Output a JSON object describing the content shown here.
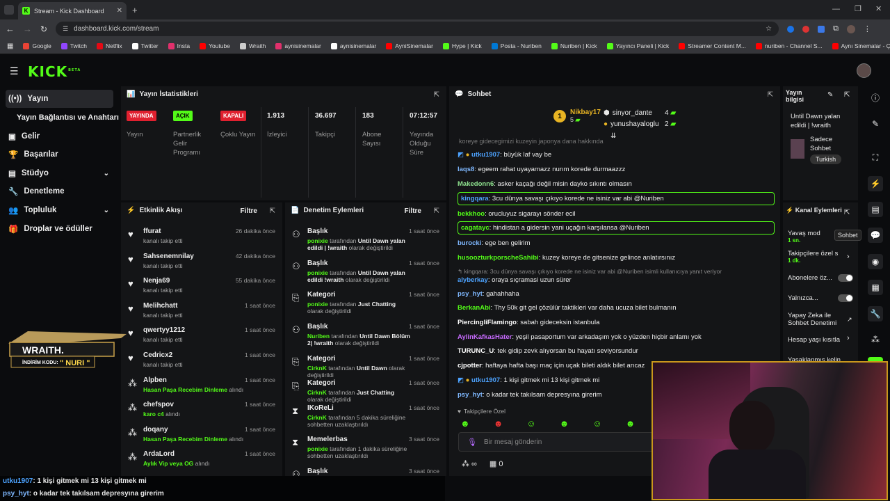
{
  "browser": {
    "tab_title": "Stream - Kick Dashboard",
    "url": "dashboard.kick.com/stream",
    "bookmarks": [
      {
        "label": "Google",
        "color": "#ea4335"
      },
      {
        "label": "Twitch",
        "color": "#9146ff"
      },
      {
        "label": "Netflix",
        "color": "#e50914"
      },
      {
        "label": "Twitter",
        "color": "#ffffff"
      },
      {
        "label": "Insta",
        "color": "#e1306c"
      },
      {
        "label": "Youtube",
        "color": "#ff0000"
      },
      {
        "label": "Wraith",
        "color": "#cccccc"
      },
      {
        "label": "aynisinemalar",
        "color": "#e1306c"
      },
      {
        "label": "aynisinemalar",
        "color": "#ffffff"
      },
      {
        "label": "AyniSinemalar",
        "color": "#ff0000"
      },
      {
        "label": "Hype | Kick",
        "color": "#53fc18"
      },
      {
        "label": "Posta - Nuriben",
        "color": "#0078d4"
      },
      {
        "label": "Nuriben | Kick",
        "color": "#53fc18"
      },
      {
        "label": "Yayıncı Paneli | Kick",
        "color": "#53fc18"
      },
      {
        "label": "Streamer Content M...",
        "color": "#ff0000"
      },
      {
        "label": "nuriben - Channel S...",
        "color": "#ff0000"
      },
      {
        "label": "Aynı Sinemalar - Ça...",
        "color": "#ff0000"
      }
    ]
  },
  "app": {
    "logo": "KICK",
    "logo_sup": "BETA"
  },
  "sidebar": {
    "items": [
      {
        "label": "Yayın",
        "icon": "broadcast-icon"
      },
      {
        "label": "Yayın Bağlantısı ve Anahtarı",
        "icon": ""
      },
      {
        "label": "Gelir",
        "icon": "revenue-icon"
      },
      {
        "label": "Başarılar",
        "icon": "trophy-icon"
      },
      {
        "label": "Stüdyo",
        "icon": "studio-icon"
      },
      {
        "label": "Denetleme",
        "icon": "wrench-icon"
      },
      {
        "label": "Topluluk",
        "icon": "people-icon"
      },
      {
        "label": "Droplar ve ödüller",
        "icon": "gift-icon"
      }
    ]
  },
  "stats": {
    "title": "Yayın İstatistikleri",
    "cols": [
      {
        "badge": "YAYINDA",
        "label": "Yayın"
      },
      {
        "badge": "AÇIK",
        "label": "Partnerlik Gelir Programı"
      },
      {
        "badge": "KAPALI",
        "label": "Çoklu Yayın"
      },
      {
        "value": "1.913",
        "label": "İzleyici"
      },
      {
        "value": "36.697",
        "label": "Takipçi"
      },
      {
        "value": "183",
        "label": "Abone Sayısı"
      },
      {
        "value": "07:12:57",
        "label": "Yayında Olduğu Süre"
      }
    ]
  },
  "activity": {
    "title": "Etkinlik Akışı",
    "filter": "Filtre",
    "items": [
      {
        "name": "ffurat",
        "sub": "kanalı takip etti",
        "time": "26 dakika önce"
      },
      {
        "name": "Sahsenemnilay",
        "sub": "kanalı takip etti",
        "time": "42 dakika önce"
      },
      {
        "name": "Nenja69",
        "sub": "kanalı takip etti",
        "time": "55 dakika önce"
      },
      {
        "name": "Melihchatt",
        "sub": "kanalı takip etti",
        "time": "1 saat önce"
      },
      {
        "name": "qwertyy1212",
        "sub": "kanalı takip etti",
        "time": "1 saat önce"
      },
      {
        "name": "Cedricx2",
        "sub": "kanalı takip etti",
        "time": "1 saat önce"
      },
      {
        "name": "Alpben",
        "sub_g": "Hasan Paşa Recebim Dinleme",
        "sub": " alındı",
        "time": "1 saat önce"
      },
      {
        "name": "chefspov",
        "sub_g": "karo c4",
        "sub": " alındı",
        "time": "1 saat önce"
      },
      {
        "name": "doqany",
        "sub_g": "Hasan Paşa Recebim Dinleme",
        "sub": " alındı",
        "time": "1 saat önce"
      },
      {
        "name": "ArdaLord",
        "sub_g": "Aylık Vip veya OG",
        "sub": " alındı",
        "time": "1 saat önce"
      }
    ]
  },
  "moderation": {
    "title": "Denetim Eylemleri",
    "filter": "Filtre",
    "items": [
      {
        "name": "Başlık",
        "time": "1 saat önce",
        "who": "ponixie",
        "mid": " tarafından ",
        "what": "Until Dawn yalan edildi | !wraith",
        "end": " olarak değiştirildi"
      },
      {
        "name": "Başlık",
        "time": "1 saat önce",
        "who": "ponixie",
        "mid": " tarafından ",
        "what": "Until Dawn yalan edildi !wraith",
        "end": " olarak değiştirildi"
      },
      {
        "name": "Kategori",
        "time": "1 saat önce",
        "who": "ponixie",
        "mid": " tarafından ",
        "what": "Just Chatting",
        "end": " olarak değiştirildi"
      },
      {
        "name": "Başlık",
        "time": "1 saat önce",
        "who": "Nuriben",
        "mid": " tarafından ",
        "what": "Until Dawn Bölüm 2| !wraith",
        "end": " olarak değiştirildi"
      },
      {
        "name": "Kategori",
        "time": "1 saat önce",
        "who": "CirknK",
        "mid": " tarafından ",
        "what": "Until Dawn",
        "end": " olarak değiştirildi"
      },
      {
        "name": "Kategori",
        "time": "1 saat önce",
        "who": "CirknK",
        "mid": " tarafından ",
        "what": "Just Chatting",
        "end": " olarak değiştirildi"
      },
      {
        "name": "IKoReLi",
        "time": "1 saat önce",
        "who": "CirknK",
        "mid": " tarafından 5 dakika süreliğine sohbetten uzaklaştırıldı",
        "what": "",
        "end": ""
      },
      {
        "name": "Memelerbas",
        "time": "3 saat önce",
        "who": "ponixie",
        "mid": " tarafından 1 dakika süreliğine sohbetten uzaklaştırıldı",
        "what": "",
        "end": ""
      },
      {
        "name": "Başlık",
        "time": "3 saat önce",
        "who": "",
        "mid": "",
        "what": "",
        "end": ""
      }
    ]
  },
  "chat": {
    "title": "Sohbet",
    "top": [
      {
        "rank": "1",
        "name": "Nikbay17",
        "count": "5"
      },
      {
        "name": "sinyor_dante",
        "count": "4"
      },
      {
        "name": "yunushayaloglu",
        "count": "2"
      }
    ],
    "messages": [
      {
        "user": "utku1907",
        "color": "#4da3ff",
        "text": "büyük laf vay be"
      },
      {
        "user": "laqs8",
        "color": "#7fb8ff",
        "text": "egeem rahat uyayamazz nurım korede durmaazzz"
      },
      {
        "user": "Makedonn6",
        "color": "#8fe38f",
        "text": "asker kaçağı değil misin dayko sıkıntı olmasın"
      },
      {
        "user": "kingqara",
        "color": "#4da3ff",
        "text": "3cu dünya savaşı çıkıyo korede ne isiniz var abi @Nuriben"
      },
      {
        "user": "bekkhoo",
        "color": "#53fc18",
        "text": "orucluyuz sigarayı sönder ecil"
      },
      {
        "user": "cagatayc",
        "color": "#53fc18",
        "text": "hindistan a gidersin yani uçağın karşılansa @Nuriben"
      },
      {
        "user": "burocki",
        "color": "#7fb8ff",
        "text": "ege ben gelirim"
      },
      {
        "user": "husoozturkporscheSahibi",
        "color": "#53fc18",
        "text": "kuzey koreye de gitsenize gelince anlatırsınız"
      },
      {
        "user": "alyberkay",
        "color": "#4da3ff",
        "text": "oraya sıçramasi uzun sürer"
      },
      {
        "user": "psy_hyt",
        "color": "#7fb8ff",
        "text": "gahahhaha"
      },
      {
        "user": "BerkanAbi",
        "color": "#53fc18",
        "text": "Thy 50k git gel çözülür taktikleri var daha ucuza bilet bulmanın"
      },
      {
        "user": "PiercingliFlamingo",
        "color": "#ffffff",
        "text": "sabah gideceksin istanbula"
      },
      {
        "user": "AylinKafkasHater",
        "color": "#c86bff",
        "text": "yeşil pasaportum var arkadaşım yok o yüzden hiçbir anlamı yok"
      },
      {
        "user": "TURUNC_U",
        "color": "#ffffff",
        "text": "tek gidip zevk alıyorsan bu hayatı seviyorsundur"
      },
      {
        "user": "cjpotter",
        "color": "#ffffff",
        "text": "haftaya hafta başı maç için uçak bileti aldık bilet arıcaz"
      },
      {
        "user": "utku1907",
        "color": "#4da3ff",
        "text": "1 kişi gitmek mi 13 kişi gitmek mi"
      },
      {
        "user": "psy_hyt",
        "color": "#7fb8ff",
        "text": "o kadar tek takılsam depresyına girerim"
      }
    ],
    "truncated_top": "koreye gidecegimizi kuzeyin japonya dana hakkında",
    "reply_ref": "kingqara: 3cu dünya savaşı çıkıyo korede ne isiniz var abi @Nuriben isimli kullanıcıya yanıt veriyor",
    "followers_only": "Takipçilere Özel",
    "input_placeholder": "Bir mesaj gönderin",
    "count_value": "0"
  },
  "stream_info": {
    "title": "Yayın bilgisi",
    "stream_title": "Until Dawn yalan edildi | !wraith",
    "category": "Sadece Sohbet",
    "tag": "Turkish"
  },
  "channel_actions": {
    "title": "Kanal Eylemleri",
    "items": [
      {
        "label": "Yavaş mod",
        "sub": "1 sn."
      },
      {
        "label": "Takipçilere özel s",
        "sub": "1 dk."
      },
      {
        "label": "Abonelere öz..."
      },
      {
        "label": "Yalnızca..."
      },
      {
        "label": "Yapay Zeka ile Sohbet Denetimi"
      },
      {
        "label": "Hesap yaşı kısıtla"
      },
      {
        "label": "Yasaklanmış kelin"
      }
    ],
    "tooltip": "Sohbet"
  },
  "overlay": {
    "wraith_brand": "WRAITH.",
    "wraith_code_label": "İNDİRİM KODU:",
    "wraith_code": "\" NURI \"",
    "bottom_chat": [
      {
        "user": "utku1907",
        "text": ": 1 kişi gitmek mi 13 kişi gitmek mi"
      },
      {
        "user": "psy_hyt",
        "text": ": o kadar tek takılsam depresyına girerim"
      }
    ]
  }
}
